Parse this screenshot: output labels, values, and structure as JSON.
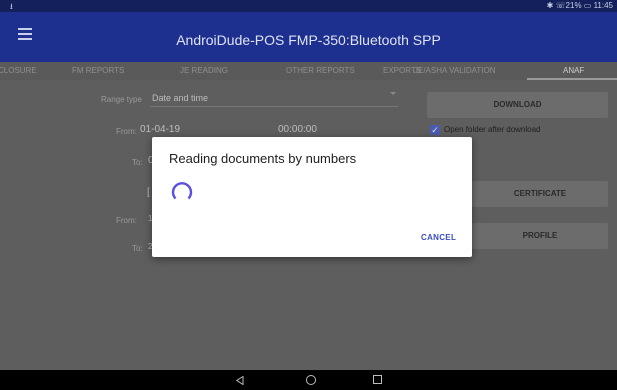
{
  "status_bar": {
    "left_icon": "usb-icon",
    "right_text": "✱ ☏21% ▭ 11:45"
  },
  "app_bar": {
    "menu_icon": "hamburger-menu-icon",
    "title": "AndroiDude-POS   FMP-350:Bluetooth SPP"
  },
  "tabs": [
    {
      "label": "Closure"
    },
    {
      "label": "FM Reports"
    },
    {
      "label": "JE Reading"
    },
    {
      "label": "Other Reports"
    },
    {
      "label": "Exports"
    },
    {
      "label": "JE/ASHA Validation"
    },
    {
      "label": "ANAF",
      "active": true
    }
  ],
  "form": {
    "range_type_label": "Range type",
    "range_type_value": "Date and time",
    "from_label": "From:",
    "from_date": "01-04-19",
    "from_time": "00:00:00",
    "to_label": "To:",
    "to_value_partial": "0",
    "bracket_partial": "[",
    "from2_label": "From:",
    "from2_partial": "1",
    "to2_label": "To:",
    "to2_partial": "2"
  },
  "actions": {
    "download_label": "Download",
    "open_folder_label": "Open folder after download",
    "open_folder_checked": true,
    "certificate_label": "Certificate",
    "profile_label": "Profile"
  },
  "dialog": {
    "title": "Reading documents by numbers",
    "cancel_label": "CANCEL",
    "accent_color": "#5b4fe0"
  },
  "nav_bar": {
    "back_icon": "back-triangle-icon",
    "home_icon": "home-circle-icon",
    "recent_icon": "recents-square-icon"
  }
}
